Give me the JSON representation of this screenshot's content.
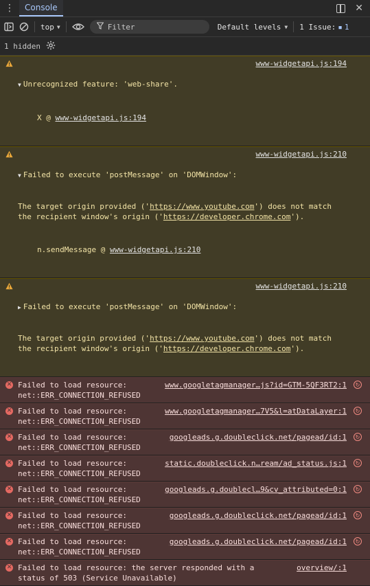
{
  "topbar": {
    "tab_label": "Console"
  },
  "toolbar": {
    "context": "top",
    "filter_placeholder": "Filter",
    "levels_label": "Default levels",
    "issues_label": "1 Issue:",
    "issues_count": "1"
  },
  "hidden_row": {
    "label": "1 hidden"
  },
  "colors": {
    "warn_bg": "#413c26",
    "err_bg": "#4e3534",
    "accent": "#a8c7fa"
  },
  "messages": [
    {
      "level": "warning",
      "source": "www-widgetapi.js:194",
      "text": "Unrecognized feature: 'web-share'.",
      "stack_prefix": "X @ ",
      "stack_link": "www-widgetapi.js:194"
    },
    {
      "level": "warning",
      "source": "www-widgetapi.js:210",
      "line1": "Failed to execute 'postMessage' on 'DOMWindow':",
      "line2a": "The target origin provided ('",
      "link1": "https://www.youtube.com",
      "line2b": "') does not match the recipient window's origin ('",
      "link2": "https://developer.chrome.com",
      "line2c": "').",
      "stack_prefix": "n.sendMessage @ ",
      "stack_link": "www-widgetapi.js:210"
    },
    {
      "level": "warning",
      "source": "www-widgetapi.js:210",
      "line1": "Failed to execute 'postMessage' on 'DOMWindow':",
      "line2a": "The target origin provided ('",
      "link1": "https://www.youtube.com",
      "line2b": "') does not match the recipient window's origin ('",
      "link2": "https://developer.chrome.com",
      "line2c": "')."
    },
    {
      "level": "error",
      "line1": "Failed to load resource:",
      "line2": "net::ERR_CONNECTION_REFUSED",
      "source": "www.googletagmanager…js?id=GTM-5QF3RT2:1"
    },
    {
      "level": "error",
      "line1": "Failed to load resource:",
      "line2": "net::ERR_CONNECTION_REFUSED",
      "source": "www.googletagmanager…7V5&l=atDataLayer:1"
    },
    {
      "level": "error",
      "line1": "Failed to load resource:",
      "line2": "net::ERR_CONNECTION_REFUSED",
      "source": "googleads.g.doubleclick.net/pagead/id:1"
    },
    {
      "level": "error",
      "line1": "Failed to load resource:",
      "line2": "net::ERR_CONNECTION_REFUSED",
      "source": "static.doubleclick.n…ream/ad_status.js:1"
    },
    {
      "level": "error",
      "line1": "Failed to load resource:",
      "line2": "net::ERR_CONNECTION_REFUSED",
      "source": "googleads.g.doublecl…9&cv_attributed=0:1"
    },
    {
      "level": "error",
      "line1": "Failed to load resource:",
      "line2": "net::ERR_CONNECTION_REFUSED",
      "source": "googleads.g.doubleclick.net/pagead/id:1"
    },
    {
      "level": "error",
      "line1": "Failed to load resource:",
      "line2": "net::ERR_CONNECTION_REFUSED",
      "source": "googleads.g.doubleclick.net/pagead/id:1"
    },
    {
      "level": "error",
      "line1": "Failed to load resource: the server responded with a",
      "line2": "status of 503 (Service Unavailable)",
      "source": "overview/:1"
    }
  ]
}
